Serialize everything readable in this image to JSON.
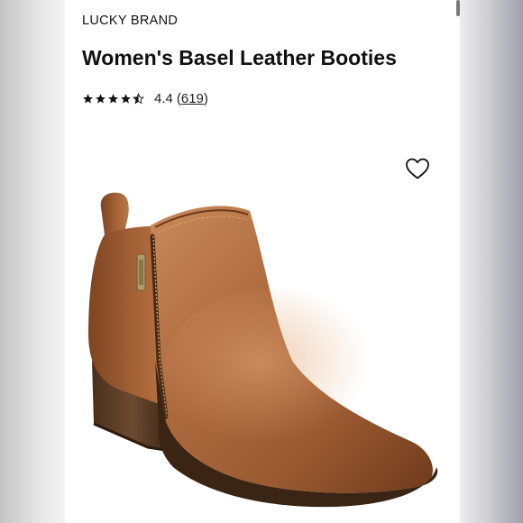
{
  "product": {
    "brand": "LUCKY BRAND",
    "title": "Women's Basel Leather Booties",
    "rating": {
      "stars_filled": 4.4,
      "stars_total": 5,
      "value": "4.4",
      "review_count": "619",
      "open_paren": "(",
      "close_paren": ")"
    },
    "wishlist_icon": "heart-outline-icon",
    "image_subject": "tan leather ankle bootie with side zipper"
  },
  "colors": {
    "text": "#111111",
    "leather": "#a8643a",
    "leather_dark": "#6b3a1c",
    "heel": "#5c3a22"
  }
}
